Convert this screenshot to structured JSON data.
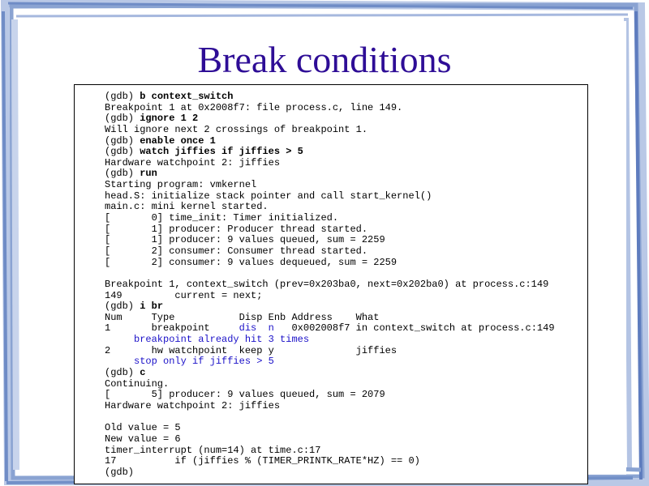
{
  "slide": {
    "title": "Break conditions"
  },
  "terminal": {
    "lines": [
      {
        "prompt": "(gdb) ",
        "cmd": "b context_switch"
      },
      {
        "text": "Breakpoint 1 at 0x2008f7: file process.c, line 149."
      },
      {
        "prompt": "(gdb) ",
        "cmd": "ignore 1 2"
      },
      {
        "text": "Will ignore next 2 crossings of breakpoint 1."
      },
      {
        "prompt": "(gdb) ",
        "cmd": "enable once 1"
      },
      {
        "prompt": "(gdb) ",
        "cmd": "watch jiffies if jiffies > 5"
      },
      {
        "text": "Hardware watchpoint 2: jiffies"
      },
      {
        "prompt": "(gdb) ",
        "cmd": "run"
      },
      {
        "text": "Starting program: vmkernel"
      },
      {
        "text": "head.S: initialize stack pointer and call start_kernel()"
      },
      {
        "text": "main.c: mini kernel started."
      },
      {
        "text": "[       0] time_init: Timer initialized."
      },
      {
        "text": "[       1] producer: Producer thread started."
      },
      {
        "text": "[       1] producer: 9 values queued, sum = 2259"
      },
      {
        "text": "[       2] consumer: Consumer thread started."
      },
      {
        "text": "[       2] consumer: 9 values dequeued, sum = 2259"
      },
      {
        "text": ""
      },
      {
        "text": "Breakpoint 1, context_switch (prev=0x203ba0, next=0x202ba0) at process.c:149"
      },
      {
        "text": "149         current = next;"
      },
      {
        "prompt": "(gdb) ",
        "cmd": "i br"
      },
      {
        "text": "Num     Type           Disp Enb Address    What"
      },
      {
        "text": "1       breakpoint     ",
        "blue": "dis  n",
        "rest": "   0x002008f7 in context_switch at process.c:149"
      },
      {
        "text": "     breakpoint already hit 3 times",
        "color": "blue"
      },
      {
        "text": "2       hw watchpoint  keep y              jiffies"
      },
      {
        "text": "     stop only if jiffies > 5",
        "color": "blue"
      },
      {
        "prompt": "(gdb) ",
        "cmd": "c"
      },
      {
        "text": "Continuing."
      },
      {
        "text": "[       5] producer: 9 values queued, sum = 2079"
      },
      {
        "text": "Hardware watchpoint 2: jiffies"
      },
      {
        "text": ""
      },
      {
        "text": "Old value = 5"
      },
      {
        "text": "New value = 6"
      },
      {
        "text": "timer_interrupt (num=14) at time.c:17"
      },
      {
        "text": "17          if (jiffies % (TIMER_PRINTK_RATE*HZ) == 0)"
      },
      {
        "text": "(gdb)"
      }
    ]
  },
  "colors": {
    "title": "#2e0d96",
    "highlight": "#1a10c8",
    "frame": "#7a96c8"
  }
}
